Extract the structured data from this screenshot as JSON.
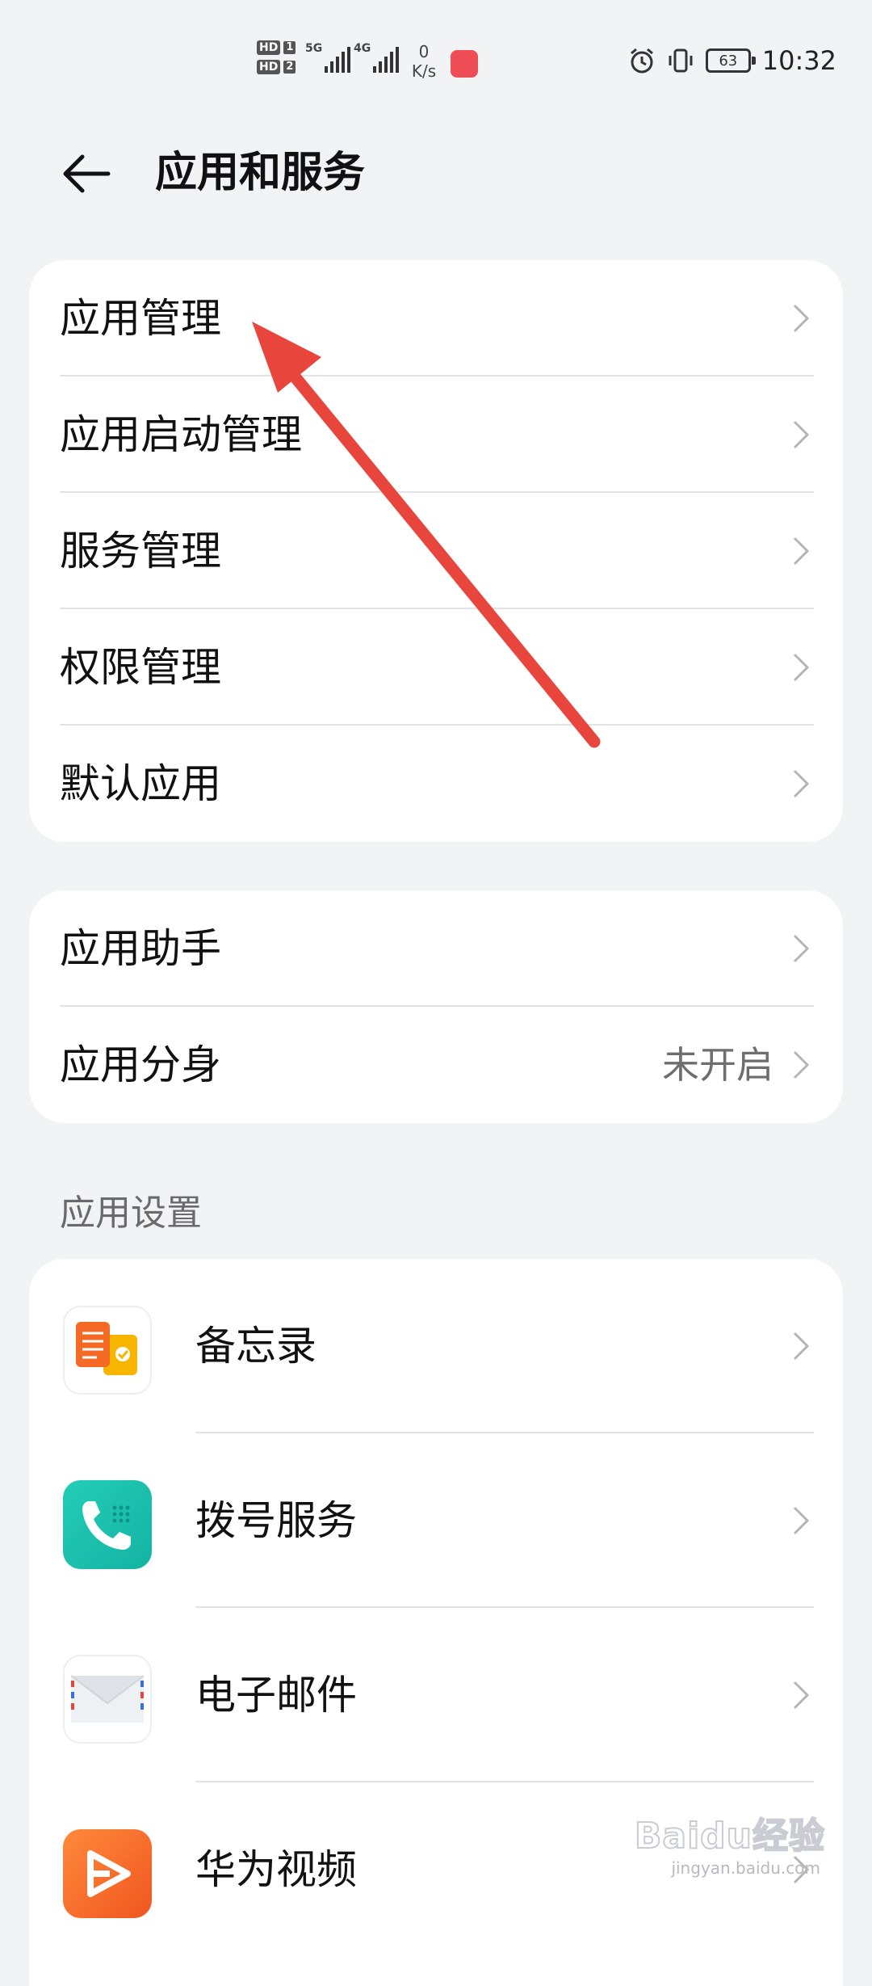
{
  "status_bar": {
    "sim1_label": "HD",
    "sim1_num": "1",
    "sim2_label": "HD",
    "sim2_num": "2",
    "network1": "5G",
    "network2": "4G",
    "speed_value": "0",
    "speed_unit": "K/s",
    "battery": "63",
    "time": "10:32"
  },
  "header": {
    "title": "应用和服务"
  },
  "group1": {
    "items": [
      {
        "label": "应用管理"
      },
      {
        "label": "应用启动管理"
      },
      {
        "label": "服务管理"
      },
      {
        "label": "权限管理"
      },
      {
        "label": "默认应用"
      }
    ]
  },
  "group2": {
    "items": [
      {
        "label": "应用助手",
        "value": ""
      },
      {
        "label": "应用分身",
        "value": "未开启"
      }
    ]
  },
  "app_settings": {
    "header": "应用设置",
    "items": [
      {
        "label": "备忘录",
        "icon": "notepad-icon"
      },
      {
        "label": "拨号服务",
        "icon": "phone-icon"
      },
      {
        "label": "电子邮件",
        "icon": "email-icon"
      },
      {
        "label": "华为视频",
        "icon": "video-icon"
      }
    ]
  },
  "watermark": {
    "text": "Baidu经验",
    "sub": "jingyan.baidu.com"
  },
  "colors": {
    "background": "#f1f3f5",
    "card": "#ffffff",
    "annotation_arrow": "#e8453c"
  }
}
